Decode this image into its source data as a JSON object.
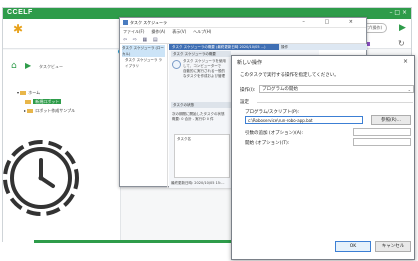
{
  "app": {
    "logo_text": "CCELF",
    "window_controls": "–  □  ×",
    "help_label": "ヘルプ(操作)",
    "breadcrumb": "タスクビュー",
    "tree": [
      {
        "label": "ホーム",
        "selected": false
      },
      {
        "label": "新規ロボット",
        "selected": true
      },
      {
        "label": "ロボット作成サンプル",
        "selected": false
      }
    ],
    "colors": {
      "brand": "#2e9c4a",
      "squares": [
        "#e8a21c",
        "#e23c3c",
        "#23a0d8",
        "#8a4fc0"
      ]
    }
  },
  "task_scheduler": {
    "title": "タスク スケジューラ",
    "window_controls": "– □ ×",
    "menu": [
      "ファイル(F)",
      "操作(A)",
      "表示(V)",
      "ヘルプ(H)"
    ],
    "toolbar": "⇦ ⇨ ▦ ▤",
    "tree": [
      "タスク スケジューラ (ローカル)",
      "タスク スケジューラ ライブラリ"
    ],
    "tab_active": "タスク スケジューラの概要 (最終更新日時 2020/10/05 ...)",
    "tab_other": "操作",
    "overview_section": "タスク スケジューラの概要",
    "overview_text": [
      "タスク スケジューラを使用",
      "して、コンピューターで",
      "自動的に実行される一般的",
      "なタスクを作成および管理"
    ],
    "status_section": "タスクの状態",
    "status_text": [
      "次の期間に開始したタスクの状態",
      "概要: 0 合計 - 実行中 0 件"
    ],
    "list_label": "タスク名",
    "updated": "最終更新日時: 2020/10/05 15:..."
  },
  "dialog": {
    "title": "新しい操作",
    "close": "×",
    "instruction": "このタスクで実行する操作を指定してください。",
    "operation_label": "操作(I):",
    "operation_value": "プログラムの開始",
    "settings_label": "設定",
    "program_label": "プログラム/スクリプト(P):",
    "program_value": "c:\\Roboservice\\run-robo-app.bat",
    "browse_label": "参照(R)...",
    "args_label": "引数の追加 (オプション)(A):",
    "start_label": "開始 (オプション)(T):",
    "ok_label": "OK",
    "cancel_label": "キャンセル"
  }
}
